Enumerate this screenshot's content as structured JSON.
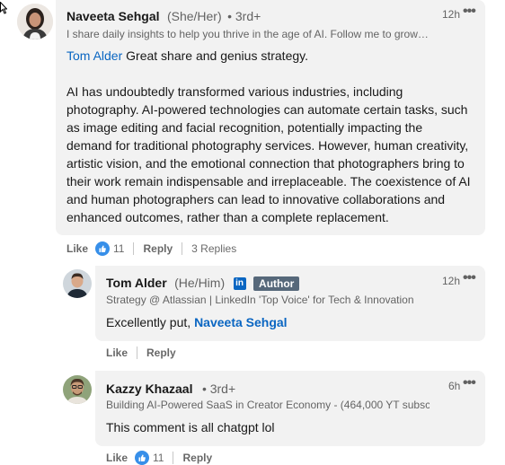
{
  "comments": [
    {
      "author": "Naveeta Sehgal",
      "pronouns": "(She/Her)",
      "degree": "• 3rd+",
      "headline": "I share daily insights to help you thrive in the age of AI. Follow me to grow…",
      "time": "12h",
      "mention": "Tom Alder",
      "first_line": " Great share and genius strategy.",
      "paragraph": "AI has undoubtedly transformed various industries, including photography. AI-powered technologies can automate certain tasks, such as image editing and facial recognition, potentially impacting the demand for traditional photography services. However, human creativity, artistic vision, and the emotional connection that photographers bring to their work remain indispensable and irreplaceable. The coexistence of AI and human photographers can lead to innovative collaborations and enhanced outcomes, rather than a complete replacement.",
      "like_label": "Like",
      "reaction_count": "11",
      "reply_label": "Reply",
      "replies_label": "3 Replies"
    }
  ],
  "replies": [
    {
      "author": "Tom Alder",
      "pronouns": "(He/Him)",
      "linkedin_badge": "in",
      "author_badge": "Author",
      "headline": "Strategy @ Atlassian | LinkedIn 'Top Voice' for Tech & Innovation",
      "time": "12h",
      "text_prefix": "Excellently put, ",
      "mention": "Naveeta Sehgal",
      "like_label": "Like",
      "reply_label": "Reply"
    },
    {
      "author": "Kazzy Khazaal",
      "degree": "• 3rd+",
      "headline": "Building AI-Powered SaaS in Creator Economy - (464,000 YT subsc…",
      "time": "6h",
      "text": "This comment is all chatgpt lol",
      "like_label": "Like",
      "reaction_count": "11",
      "reply_label": "Reply"
    }
  ],
  "colors": {
    "link": "#0a66c2",
    "bubble": "#f2f2f2",
    "author_badge": "#56687a"
  }
}
